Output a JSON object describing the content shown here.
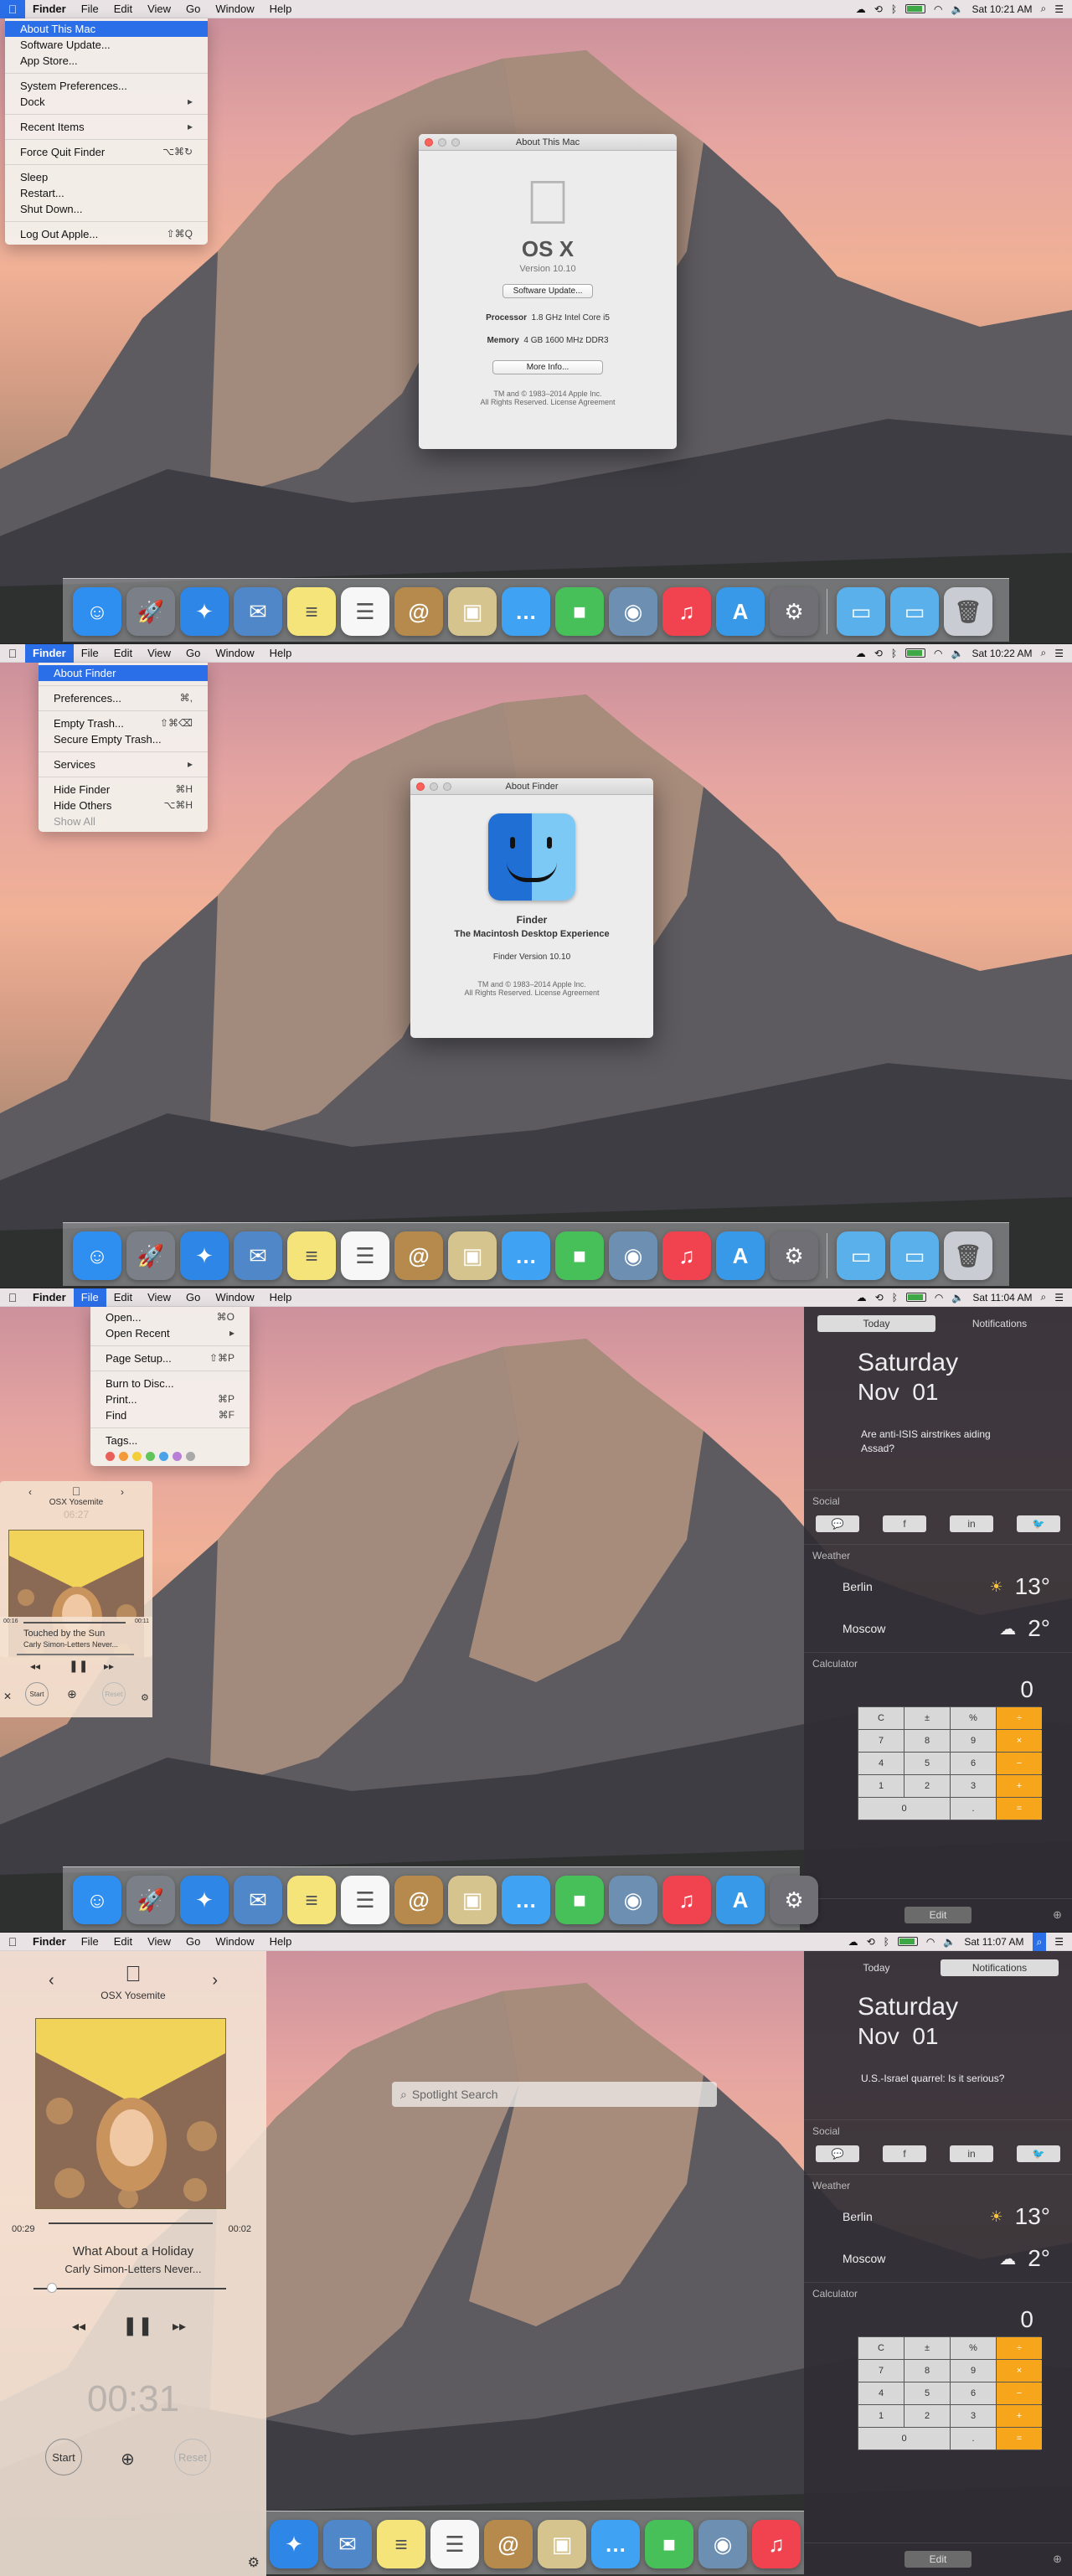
{
  "panels": [
    {
      "menubar": {
        "items": [
          "Finder",
          "File",
          "Edit",
          "View",
          "Go",
          "Window",
          "Help"
        ],
        "selected": "apple",
        "clock": "Sat 10:21 AM"
      },
      "menu": {
        "kind": "apple",
        "items": [
          {
            "label": "About This Mac",
            "shortcut": "",
            "selected": true
          },
          {
            "label": "Software Update...",
            "shortcut": ""
          },
          {
            "label": "App Store...",
            "shortcut": ""
          },
          {
            "sep": true
          },
          {
            "label": "System Preferences...",
            "shortcut": ""
          },
          {
            "label": "Dock",
            "shortcut": "▸"
          },
          {
            "sep": true
          },
          {
            "label": "Recent Items",
            "shortcut": "▸"
          },
          {
            "sep": true
          },
          {
            "label": "Force Quit Finder",
            "shortcut": "⌥⌘↻"
          },
          {
            "sep": true
          },
          {
            "label": "Sleep",
            "shortcut": ""
          },
          {
            "label": "Restart...",
            "shortcut": ""
          },
          {
            "label": "Shut Down...",
            "shortcut": ""
          },
          {
            "sep": true
          },
          {
            "label": "Log Out Apple...",
            "shortcut": "⇧⌘Q"
          }
        ]
      },
      "about_mac": {
        "title": "About This Mac",
        "os": "OS X",
        "version": "Version 10.10",
        "update_btn": "Software Update...",
        "processor_label": "Processor",
        "processor": "1.8 GHz Intel Core i5",
        "memory_label": "Memory",
        "memory": "4 GB 1600 MHz DDR3",
        "more_btn": "More Info...",
        "legal1": "TM and © 1983–2014 Apple Inc.",
        "legal2": "All Rights Reserved.  License Agreement"
      }
    },
    {
      "menubar": {
        "items": [
          "Finder",
          "File",
          "Edit",
          "View",
          "Go",
          "Window",
          "Help"
        ],
        "selected": "Finder",
        "clock": "Sat 10:22 AM"
      },
      "menu": {
        "kind": "finder",
        "items": [
          {
            "label": "About Finder",
            "shortcut": "",
            "selected": true
          },
          {
            "sep": true
          },
          {
            "label": "Preferences...",
            "shortcut": "⌘,"
          },
          {
            "sep": true
          },
          {
            "label": "Empty Trash...",
            "shortcut": "⇧⌘⌫"
          },
          {
            "label": "Secure Empty Trash...",
            "shortcut": ""
          },
          {
            "sep": true
          },
          {
            "label": "Services",
            "shortcut": "▸"
          },
          {
            "sep": true
          },
          {
            "label": "Hide Finder",
            "shortcut": "⌘H"
          },
          {
            "label": "Hide Others",
            "shortcut": "⌥⌘H"
          },
          {
            "label": "Show All",
            "shortcut": "",
            "disabled": true
          }
        ]
      },
      "about_finder": {
        "title": "About Finder",
        "name": "Finder",
        "tagline": "The Macintosh Desktop Experience",
        "version": "Finder Version 10.10",
        "legal1": "TM and © 1983–2014 Apple Inc.",
        "legal2": "All Rights Reserved.  License Agreement"
      }
    },
    {
      "menubar": {
        "items": [
          "Finder",
          "File",
          "Edit",
          "View",
          "Go",
          "Window",
          "Help"
        ],
        "selected": "File",
        "clock": "Sat 11:04 AM"
      },
      "menu": {
        "kind": "file",
        "items": [
          {
            "label": "Open...",
            "shortcut": "⌘O"
          },
          {
            "label": "Open Recent",
            "shortcut": "▸"
          },
          {
            "sep": true
          },
          {
            "label": "Page Setup...",
            "shortcut": "⇧⌘P"
          },
          {
            "sep": true
          },
          {
            "label": "Burn to Disc...",
            "shortcut": ""
          },
          {
            "label": "Print...",
            "shortcut": "⌘P"
          },
          {
            "label": "Find",
            "shortcut": "⌘F"
          },
          {
            "sep": true
          },
          {
            "label": "Tags...",
            "shortcut": ""
          }
        ]
      },
      "tag_colors": [
        "#e9605a",
        "#f39a3a",
        "#f2cf3a",
        "#62c55b",
        "#4aa3e8",
        "#b77fd6",
        "#a9a9a9"
      ],
      "notifications": {
        "tab_today": "Today",
        "tab_notifications": "Notifications",
        "day": "Saturday",
        "date": "Nov  01",
        "headline": "Are anti-ISIS airstrikes aiding Assad?",
        "social_label": "Social",
        "weather_label": "Weather",
        "weather": [
          {
            "city": "Berlin",
            "temp": "13°",
            "icon": "sun"
          },
          {
            "city": "Moscow",
            "temp": "2°",
            "icon": "cloud"
          }
        ],
        "calc_label": "Calculator",
        "calc_display": "0",
        "edit": "Edit"
      },
      "player": {
        "brand": "OSX Yosemite",
        "time_top": "06:27",
        "elapsed": "00:16",
        "remaining": "00:11",
        "song": "Touched by the Sun",
        "artist": "Carly Simon-Letters Never...",
        "start": "Start",
        "reset": "Reset",
        "album_title": "Carly Simon Letters Never Sent"
      }
    },
    {
      "menubar": {
        "items": [
          "Finder",
          "File",
          "Edit",
          "View",
          "Go",
          "Window",
          "Help"
        ],
        "selected": "",
        "clock": "Sat 11:07 AM"
      },
      "spotlight": {
        "placeholder": "Spotlight Search"
      },
      "notifications": {
        "tab_today": "Today",
        "tab_notifications": "Notifications",
        "day": "Saturday",
        "date": "Nov  01",
        "headline": "U.S.-Israel quarrel: Is it serious?",
        "social_label": "Social",
        "weather_label": "Weather",
        "weather": [
          {
            "city": "Berlin",
            "temp": "13°",
            "icon": "sun"
          },
          {
            "city": "Moscow",
            "temp": "2°",
            "icon": "cloud"
          }
        ],
        "calc_label": "Calculator",
        "calc_display": "0",
        "edit": "Edit"
      },
      "player": {
        "brand": "OSX Yosemite",
        "elapsed": "00:29",
        "remaining": "00:02",
        "song": "What About a Holiday",
        "artist": "Carly Simon-Letters Never...",
        "timer": "00:31",
        "start": "Start",
        "reset": "Reset",
        "album_title": "Carly Simon Letters Never Sent"
      }
    }
  ],
  "calc_keys": [
    "C",
    "±",
    "%",
    "÷",
    "7",
    "8",
    "9",
    "×",
    "4",
    "5",
    "6",
    "−",
    "1",
    "2",
    "3",
    "+",
    "0",
    ".",
    "="
  ],
  "dock_apps": [
    {
      "name": "finder",
      "glyph": "☺",
      "color": "#2f8ff0"
    },
    {
      "name": "launchpad",
      "glyph": "🚀",
      "color": "#7a7f88"
    },
    {
      "name": "safari",
      "glyph": "✦",
      "color": "#2e86e6"
    },
    {
      "name": "mail",
      "glyph": "✉",
      "color": "#4f87c8"
    },
    {
      "name": "notes",
      "glyph": "≡",
      "color": "#f4e47a"
    },
    {
      "name": "reminders",
      "glyph": "☰",
      "color": "#f7f7f7"
    },
    {
      "name": "contacts",
      "glyph": "@",
      "color": "#b58a4c"
    },
    {
      "name": "preview",
      "glyph": "▣",
      "color": "#d6c48e"
    },
    {
      "name": "messages",
      "glyph": "…",
      "color": "#3fa2f2"
    },
    {
      "name": "facetime",
      "glyph": "■",
      "color": "#47c05a"
    },
    {
      "name": "iphoto",
      "glyph": "◉",
      "color": "#6d8fb2"
    },
    {
      "name": "itunes",
      "glyph": "♫",
      "color": "#f0424f"
    },
    {
      "name": "app-store",
      "glyph": "A",
      "color": "#3799e8"
    },
    {
      "name": "system-preferences",
      "glyph": "⚙",
      "color": "#6f6f75"
    },
    {
      "name": "applications-folder",
      "glyph": "▭",
      "color": "#5ab0ea"
    },
    {
      "name": "documents-folder",
      "glyph": "▭",
      "color": "#5ab0ea"
    },
    {
      "name": "trash",
      "glyph": "🗑",
      "color": "#c9ccd2"
    }
  ]
}
